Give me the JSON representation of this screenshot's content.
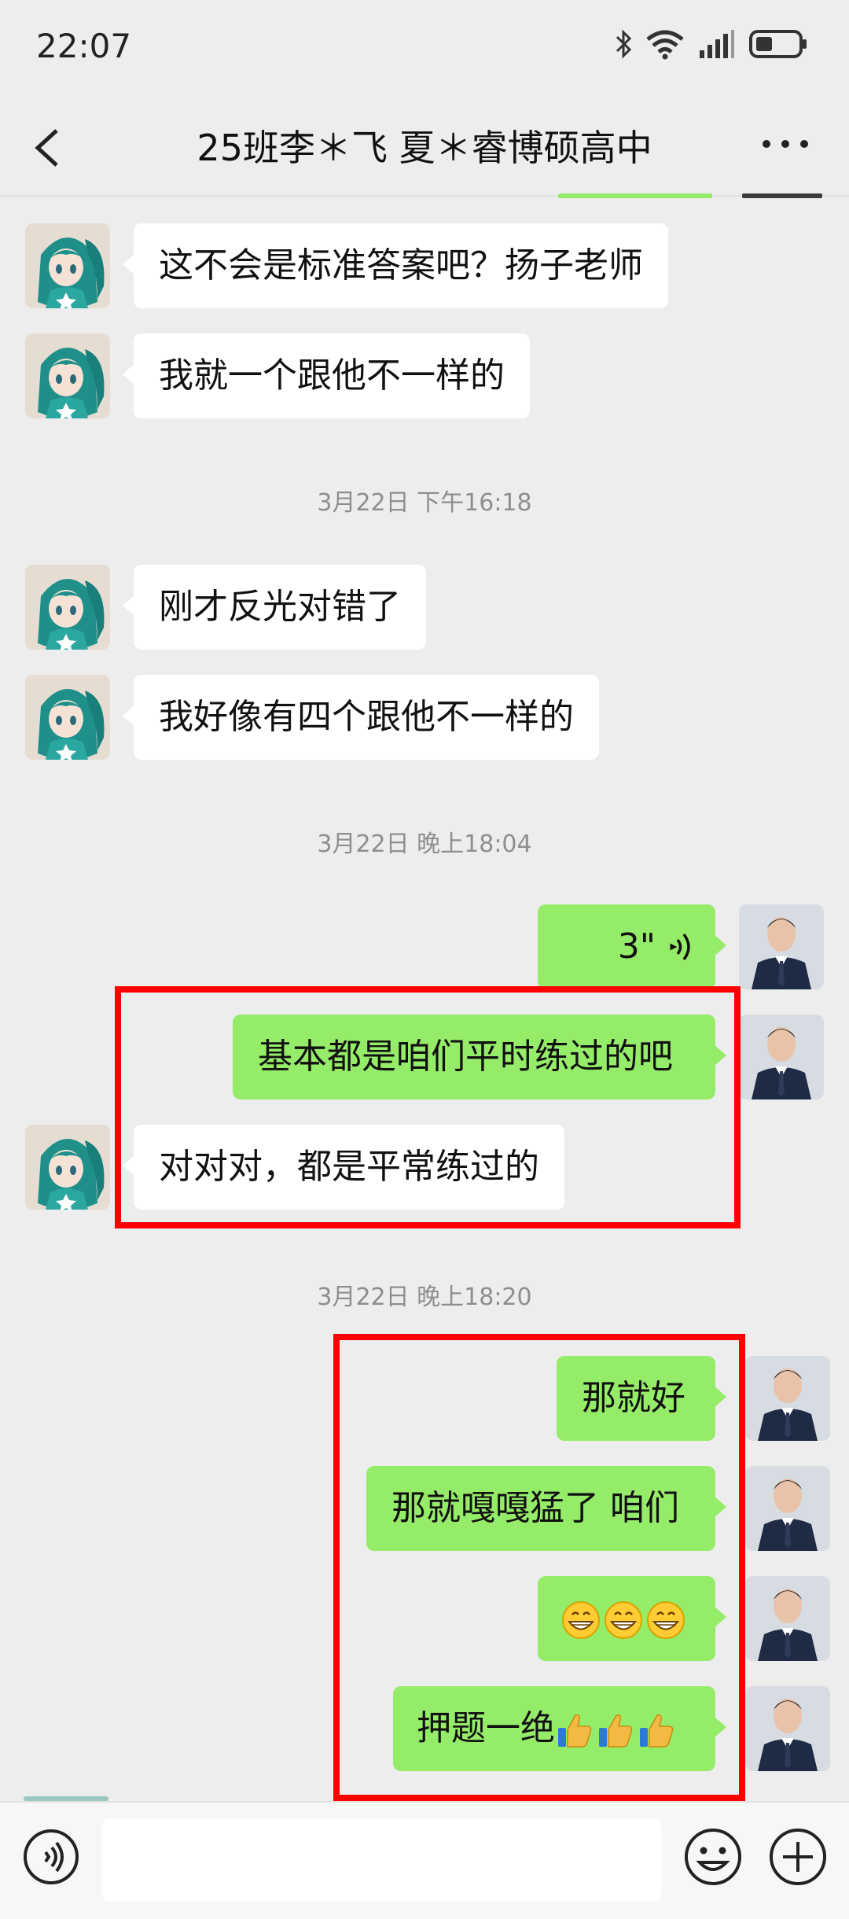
{
  "status_bar": {
    "time": "22:07"
  },
  "header": {
    "title": "25班李＊飞 夏＊睿博硕高中"
  },
  "messages": [
    {
      "side": "in",
      "text": "这不会是标准答案吧？扬子老师"
    },
    {
      "side": "in",
      "text": "我就一个跟他不一样的"
    },
    {
      "side": "in",
      "text": "刚才反光对错了"
    },
    {
      "side": "in",
      "text": "我好像有四个跟他不一样的"
    },
    {
      "side": "out",
      "type": "voice",
      "text": "3\""
    },
    {
      "side": "out",
      "text": "基本都是咱们平时练过的吧"
    },
    {
      "side": "in",
      "text": "对对对，都是平常练过的"
    },
    {
      "side": "out",
      "text": "那就好"
    },
    {
      "side": "out",
      "text": "那就嘎嘎猛了 咱们"
    },
    {
      "side": "out",
      "type": "emoji",
      "emoji": [
        "grin-icon",
        "grin-icon",
        "grin-icon"
      ]
    },
    {
      "side": "out",
      "text": "押题一绝",
      "emoji": [
        "thumbs-up-icon",
        "thumbs-up-icon",
        "thumbs-up-icon"
      ]
    }
  ],
  "timestamps": [
    "3月22日 下午16:18",
    "3月22日 晚上18:04",
    "3月22日 晚上18:20"
  ],
  "input_bar": {
    "placeholder": ""
  },
  "colors": {
    "background": "#ededed",
    "outgoing_bubble": "#95ec69",
    "incoming_bubble": "#ffffff",
    "highlight": "#ff0000",
    "timestamp_text": "#8e8e8e"
  }
}
